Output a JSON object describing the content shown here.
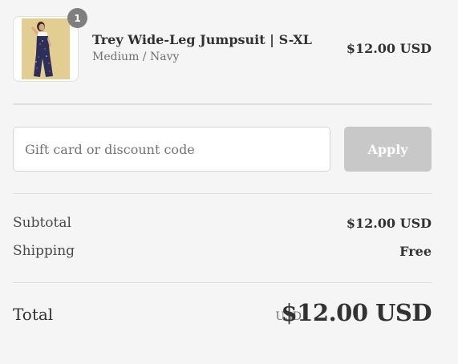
{
  "product": {
    "quantity": "1",
    "title": "Trey Wide-Leg Jumpsuit | S-XL",
    "variant": "Medium / Navy",
    "price": "$12.00 USD",
    "image_alt": "Trey Wide-Leg Jumpsuit"
  },
  "discount": {
    "placeholder": "Gift card or discount code",
    "value": "",
    "apply_label": "Apply"
  },
  "costs": {
    "subtotal_label": "Subtotal",
    "subtotal_value": "$12.00 USD",
    "shipping_label": "Shipping",
    "shipping_value": "Free"
  },
  "total": {
    "label": "Total",
    "currency": "USD",
    "amount": "$12.00 USD"
  },
  "colors": {
    "background": "#f5f5f5",
    "divider": "#dedede",
    "badge": "#7f7f7f",
    "apply_disabled": "#c8c8c8",
    "text_primary": "#323232",
    "text_muted": "#717171"
  }
}
